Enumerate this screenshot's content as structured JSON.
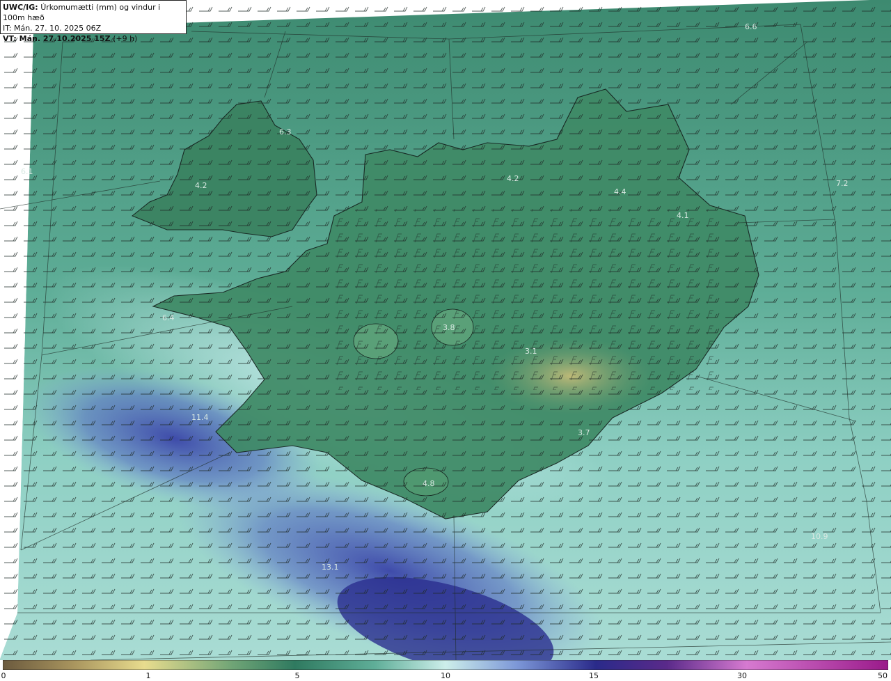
{
  "header": {
    "model": "UWC/IG:",
    "description": "Úrkomumætti (mm) og vindur i 100m hæð",
    "init_time": "IT: Mán. 27. 10. 2025 06Z",
    "valid_time_label": "VT: Mán. 27.10.2025 15Z",
    "valid_time_offset": "(+9 h)"
  },
  "legend": {
    "ticks": [
      "0",
      "1",
      "5",
      "10",
      "15",
      "30",
      "50"
    ],
    "colors": [
      "#6b5a3e",
      "#c9b77a",
      "#e8dc8e",
      "#3f8c6a",
      "#2f7a60",
      "#7fc6b8",
      "#cdeeea",
      "#5a78c8",
      "#3a3aa0",
      "#2a2a8a",
      "#7a3a9a",
      "#d67ad0",
      "#b02a9a"
    ]
  },
  "map_labels": [
    {
      "text": "6.6"
    },
    {
      "text": "4.2"
    },
    {
      "text": "4.2"
    },
    {
      "text": "4.4"
    },
    {
      "text": "4.1"
    },
    {
      "text": "7.2"
    },
    {
      "text": "3.8"
    },
    {
      "text": "3.1"
    },
    {
      "text": "3.7"
    },
    {
      "text": "4.8"
    },
    {
      "text": "11.4"
    },
    {
      "text": "13.1"
    },
    {
      "text": "10.9"
    },
    {
      "text": "6.1"
    },
    {
      "text": "6.4"
    },
    {
      "text": "6.3"
    }
  ]
}
